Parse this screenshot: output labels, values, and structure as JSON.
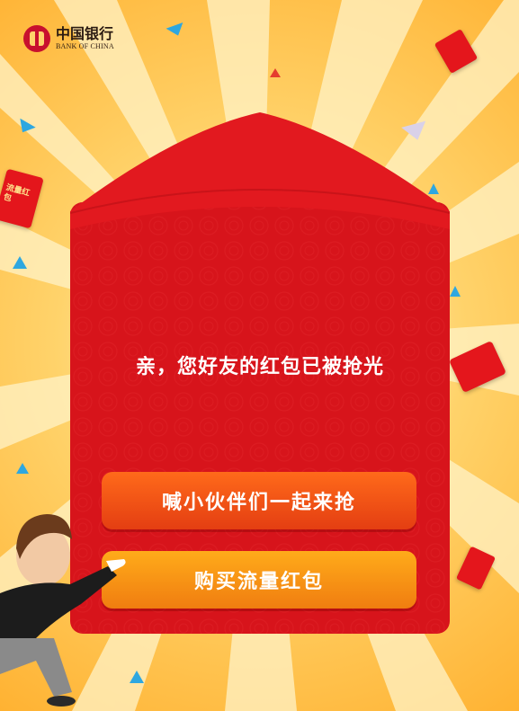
{
  "logo": {
    "name_cn": "中国银行",
    "name_en": "BANK OF CHINA"
  },
  "message": "亲，您好友的红包已被抢光",
  "buttons": {
    "invite": "喊小伙伴们一起来抢",
    "buy": "购买流量红包"
  },
  "decorations": {
    "side_envelope_left_label": "流量红包"
  },
  "colors": {
    "envelope_red": "#d7141b",
    "flap_red": "#e2191f",
    "invite_button": "#f0541a",
    "buy_button": "#f39512",
    "background_yellow": "#ffd36b"
  }
}
